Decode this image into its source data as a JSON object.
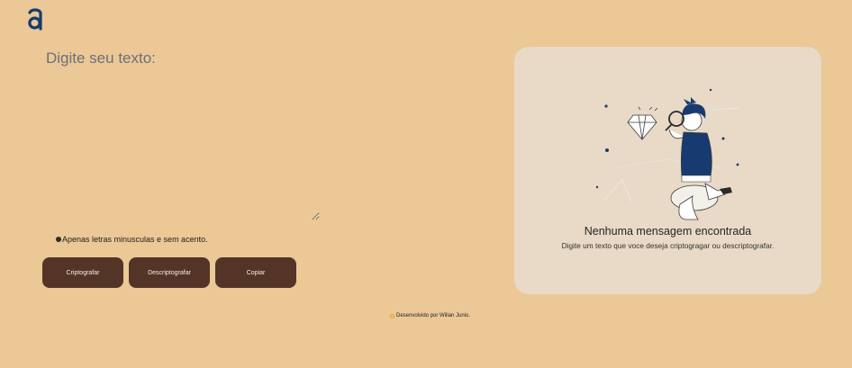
{
  "input": {
    "placeholder": "Digite seu texto:",
    "value": ""
  },
  "hint": {
    "text": "Apenas letras minusculas e sem acento."
  },
  "buttons": {
    "encrypt": "Criptografar",
    "decrypt": "Descriptografar",
    "copy": "Copiar"
  },
  "output": {
    "title": "Nenhuma mensagem encontrada",
    "subtitle": "Digite um texto que voce deseja criptogragar ou descriptografar."
  },
  "footer": {
    "text": "Desenvolvido por Willan Junio."
  },
  "colors": {
    "background": "#ebc896",
    "button": "#543426",
    "panel": "#e8dac6",
    "logo": "#173a70"
  },
  "icons": {
    "logo": "logo-a-icon",
    "hint": "info-icon",
    "footer": "copyright-icon",
    "illustration": "person-magnifier-diamond-illustration"
  }
}
